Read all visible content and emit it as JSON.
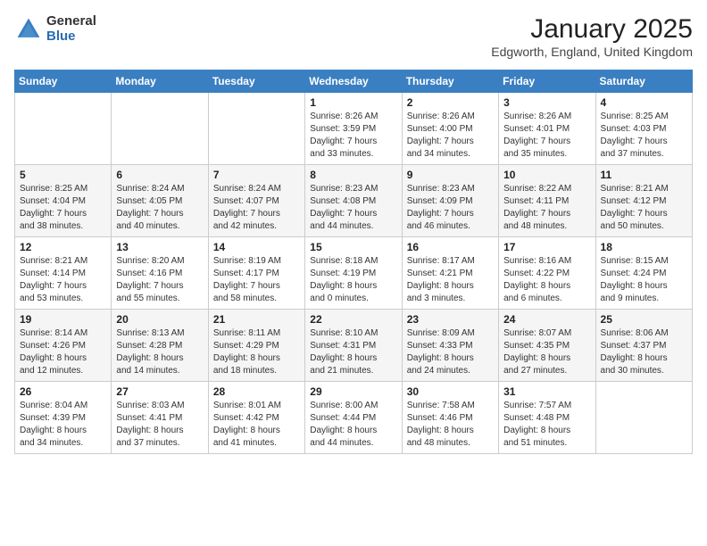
{
  "logo": {
    "general": "General",
    "blue": "Blue"
  },
  "header": {
    "title": "January 2025",
    "location": "Edgworth, England, United Kingdom"
  },
  "weekdays": [
    "Sunday",
    "Monday",
    "Tuesday",
    "Wednesday",
    "Thursday",
    "Friday",
    "Saturday"
  ],
  "weeks": [
    [
      {
        "day": "",
        "info": ""
      },
      {
        "day": "",
        "info": ""
      },
      {
        "day": "",
        "info": ""
      },
      {
        "day": "1",
        "info": "Sunrise: 8:26 AM\nSunset: 3:59 PM\nDaylight: 7 hours\nand 33 minutes."
      },
      {
        "day": "2",
        "info": "Sunrise: 8:26 AM\nSunset: 4:00 PM\nDaylight: 7 hours\nand 34 minutes."
      },
      {
        "day": "3",
        "info": "Sunrise: 8:26 AM\nSunset: 4:01 PM\nDaylight: 7 hours\nand 35 minutes."
      },
      {
        "day": "4",
        "info": "Sunrise: 8:25 AM\nSunset: 4:03 PM\nDaylight: 7 hours\nand 37 minutes."
      }
    ],
    [
      {
        "day": "5",
        "info": "Sunrise: 8:25 AM\nSunset: 4:04 PM\nDaylight: 7 hours\nand 38 minutes."
      },
      {
        "day": "6",
        "info": "Sunrise: 8:24 AM\nSunset: 4:05 PM\nDaylight: 7 hours\nand 40 minutes."
      },
      {
        "day": "7",
        "info": "Sunrise: 8:24 AM\nSunset: 4:07 PM\nDaylight: 7 hours\nand 42 minutes."
      },
      {
        "day": "8",
        "info": "Sunrise: 8:23 AM\nSunset: 4:08 PM\nDaylight: 7 hours\nand 44 minutes."
      },
      {
        "day": "9",
        "info": "Sunrise: 8:23 AM\nSunset: 4:09 PM\nDaylight: 7 hours\nand 46 minutes."
      },
      {
        "day": "10",
        "info": "Sunrise: 8:22 AM\nSunset: 4:11 PM\nDaylight: 7 hours\nand 48 minutes."
      },
      {
        "day": "11",
        "info": "Sunrise: 8:21 AM\nSunset: 4:12 PM\nDaylight: 7 hours\nand 50 minutes."
      }
    ],
    [
      {
        "day": "12",
        "info": "Sunrise: 8:21 AM\nSunset: 4:14 PM\nDaylight: 7 hours\nand 53 minutes."
      },
      {
        "day": "13",
        "info": "Sunrise: 8:20 AM\nSunset: 4:16 PM\nDaylight: 7 hours\nand 55 minutes."
      },
      {
        "day": "14",
        "info": "Sunrise: 8:19 AM\nSunset: 4:17 PM\nDaylight: 7 hours\nand 58 minutes."
      },
      {
        "day": "15",
        "info": "Sunrise: 8:18 AM\nSunset: 4:19 PM\nDaylight: 8 hours\nand 0 minutes."
      },
      {
        "day": "16",
        "info": "Sunrise: 8:17 AM\nSunset: 4:21 PM\nDaylight: 8 hours\nand 3 minutes."
      },
      {
        "day": "17",
        "info": "Sunrise: 8:16 AM\nSunset: 4:22 PM\nDaylight: 8 hours\nand 6 minutes."
      },
      {
        "day": "18",
        "info": "Sunrise: 8:15 AM\nSunset: 4:24 PM\nDaylight: 8 hours\nand 9 minutes."
      }
    ],
    [
      {
        "day": "19",
        "info": "Sunrise: 8:14 AM\nSunset: 4:26 PM\nDaylight: 8 hours\nand 12 minutes."
      },
      {
        "day": "20",
        "info": "Sunrise: 8:13 AM\nSunset: 4:28 PM\nDaylight: 8 hours\nand 14 minutes."
      },
      {
        "day": "21",
        "info": "Sunrise: 8:11 AM\nSunset: 4:29 PM\nDaylight: 8 hours\nand 18 minutes."
      },
      {
        "day": "22",
        "info": "Sunrise: 8:10 AM\nSunset: 4:31 PM\nDaylight: 8 hours\nand 21 minutes."
      },
      {
        "day": "23",
        "info": "Sunrise: 8:09 AM\nSunset: 4:33 PM\nDaylight: 8 hours\nand 24 minutes."
      },
      {
        "day": "24",
        "info": "Sunrise: 8:07 AM\nSunset: 4:35 PM\nDaylight: 8 hours\nand 27 minutes."
      },
      {
        "day": "25",
        "info": "Sunrise: 8:06 AM\nSunset: 4:37 PM\nDaylight: 8 hours\nand 30 minutes."
      }
    ],
    [
      {
        "day": "26",
        "info": "Sunrise: 8:04 AM\nSunset: 4:39 PM\nDaylight: 8 hours\nand 34 minutes."
      },
      {
        "day": "27",
        "info": "Sunrise: 8:03 AM\nSunset: 4:41 PM\nDaylight: 8 hours\nand 37 minutes."
      },
      {
        "day": "28",
        "info": "Sunrise: 8:01 AM\nSunset: 4:42 PM\nDaylight: 8 hours\nand 41 minutes."
      },
      {
        "day": "29",
        "info": "Sunrise: 8:00 AM\nSunset: 4:44 PM\nDaylight: 8 hours\nand 44 minutes."
      },
      {
        "day": "30",
        "info": "Sunrise: 7:58 AM\nSunset: 4:46 PM\nDaylight: 8 hours\nand 48 minutes."
      },
      {
        "day": "31",
        "info": "Sunrise: 7:57 AM\nSunset: 4:48 PM\nDaylight: 8 hours\nand 51 minutes."
      },
      {
        "day": "",
        "info": ""
      }
    ]
  ]
}
